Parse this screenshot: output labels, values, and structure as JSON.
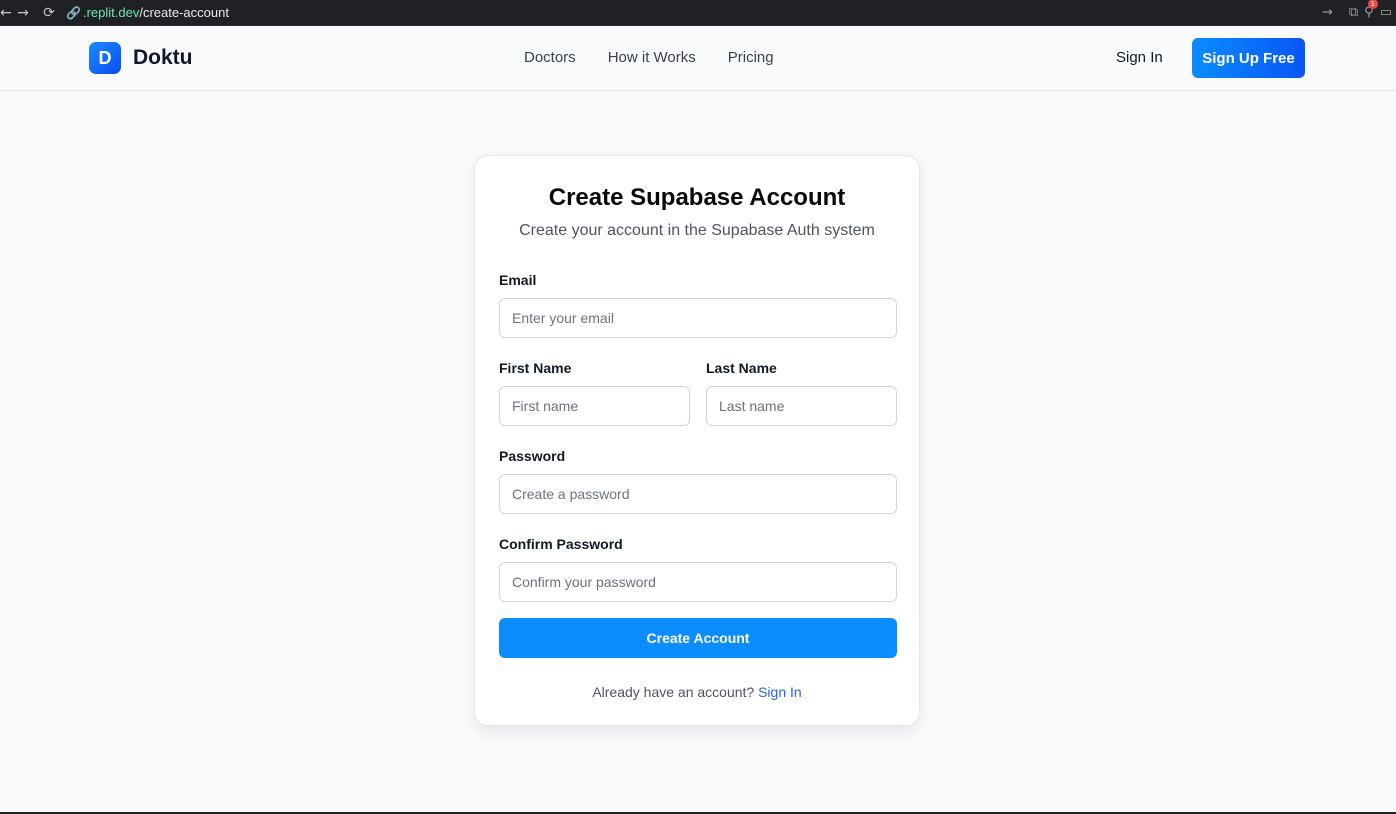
{
  "browser": {
    "nav_back": "←",
    "nav_forward": "→",
    "reload": "⟳",
    "link_icon": "🔗",
    "url_host": ".replit.dev",
    "url_path": "/create-account",
    "right_icons": [
      "→",
      "⧉",
      "⚲",
      "▭"
    ],
    "ext_badge_count": "1"
  },
  "header": {
    "logo_letter": "D",
    "brand": "Doktu",
    "nav": [
      "Doctors",
      "How it Works",
      "Pricing"
    ],
    "sign_in": "Sign In",
    "sign_up": "Sign Up Free"
  },
  "card": {
    "title": "Create Supabase Account",
    "subtitle": "Create your account in the Supabase Auth system",
    "email_label": "Email",
    "email_placeholder": "Enter your email",
    "first_name_label": "First Name",
    "first_name_placeholder": "First name",
    "last_name_label": "Last Name",
    "last_name_placeholder": "Last name",
    "password_label": "Password",
    "password_placeholder": "Create a password",
    "confirm_label": "Confirm Password",
    "confirm_placeholder": "Confirm your password",
    "submit": "Create Account",
    "footer_text": "Already have an account?",
    "footer_link": "Sign In"
  },
  "colors": {
    "accent": "#0b8cff",
    "link": "#2563eb",
    "page_bg": "#f8fafc"
  }
}
